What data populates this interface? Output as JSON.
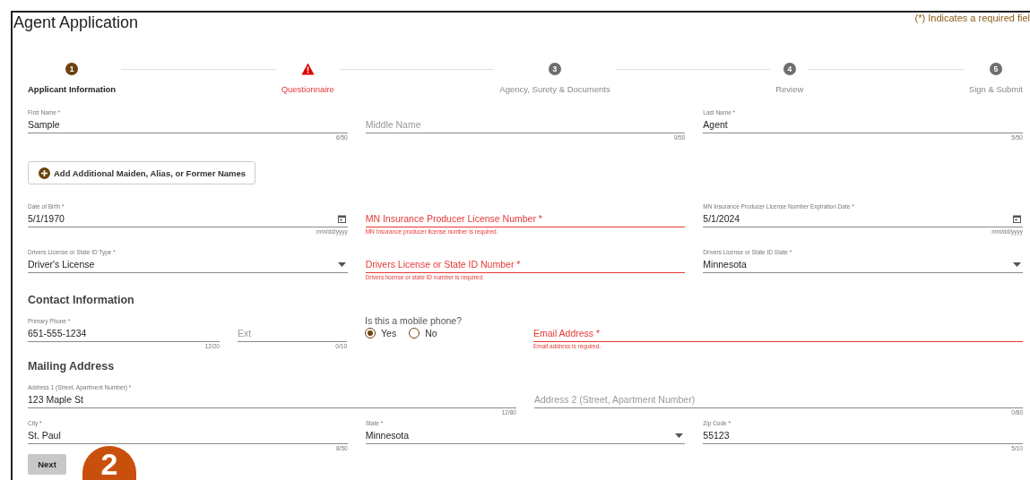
{
  "title": "Agent Application",
  "required_note": "(*) Indicates a required fiel",
  "steps": [
    {
      "number": "1",
      "label": "Applicant Information",
      "selected": true,
      "error": false
    },
    {
      "label": "Questionnaire",
      "selected": false,
      "error": true
    },
    {
      "number": "3",
      "label": "Agency, Surety & Documents",
      "selected": false,
      "error": false
    },
    {
      "number": "4",
      "label": "Review",
      "selected": false,
      "error": false
    },
    {
      "number": "5",
      "label": "Sign & Submit",
      "selected": false,
      "error": false
    }
  ],
  "rows": [
    {
      "kind": "three",
      "fields": [
        {
          "kind": "text",
          "label": "First Name *",
          "value": "Sample",
          "counter": "6/50"
        },
        {
          "kind": "empty",
          "placeholder": "Middle Name",
          "counter": "0/50"
        },
        {
          "kind": "text",
          "label": "Last Name *",
          "value": "Agent",
          "counter": "5/50"
        }
      ]
    },
    {
      "kind": "add_button",
      "label": "Add Additional Maiden, Alias, or Former Names"
    },
    {
      "kind": "three",
      "fields": [
        {
          "kind": "date",
          "label": "Date of Birth *",
          "value": "5/1/1970",
          "hint": "mm/dd/yyyy"
        },
        {
          "kind": "error",
          "label": "MN Insurance Producer License Number *",
          "error": "MN Insurance producer license number is required."
        },
        {
          "kind": "date",
          "label": "MN Insurance Producer License Number Expiration Date *",
          "value": "5/1/2024",
          "hint": "mm/dd/yyyy"
        }
      ]
    },
    {
      "kind": "three",
      "fields": [
        {
          "kind": "select",
          "label": "Drivers License or State ID Type *",
          "value": "Driver's License"
        },
        {
          "kind": "error",
          "label": "Drivers License or State ID Number *",
          "error": "Drivers license or state ID number is required."
        },
        {
          "kind": "select",
          "label": "Drivers License or State ID State *",
          "value": "Minnesota"
        }
      ]
    },
    {
      "kind": "heading",
      "text": "Contact Information"
    },
    {
      "kind": "contact",
      "fields": [
        {
          "kind": "text",
          "label": "Primary Phone *",
          "value": "651-555-1234",
          "counter": "12/20"
        },
        {
          "kind": "empty",
          "placeholder": "Ext",
          "counter": "0/10"
        },
        {
          "kind": "radio",
          "question": "Is this a mobile phone?",
          "options": [
            {
              "label": "Yes",
              "selected": true
            },
            {
              "label": "No",
              "selected": false
            }
          ]
        },
        {
          "kind": "error",
          "label": "Email Address *",
          "error": "Email address is required."
        }
      ]
    },
    {
      "kind": "heading",
      "text": "Mailing Address"
    },
    {
      "kind": "two",
      "fields": [
        {
          "kind": "text",
          "label": "Address 1 (Street, Apartment Number) *",
          "value": "123 Maple St",
          "counter": "12/80"
        },
        {
          "kind": "empty",
          "placeholder": "Address 2 (Street, Apartment Number)",
          "counter": "0/80"
        }
      ]
    },
    {
      "kind": "three",
      "fields": [
        {
          "kind": "text",
          "label": "City *",
          "value": "St. Paul",
          "counter": "8/50"
        },
        {
          "kind": "select",
          "label": "State *",
          "value": "Minnesota"
        },
        {
          "kind": "text",
          "label": "Zip Code *",
          "value": "55123",
          "counter": "5/10"
        }
      ]
    },
    {
      "kind": "next_button",
      "label": "Next"
    }
  ],
  "callout": "2"
}
